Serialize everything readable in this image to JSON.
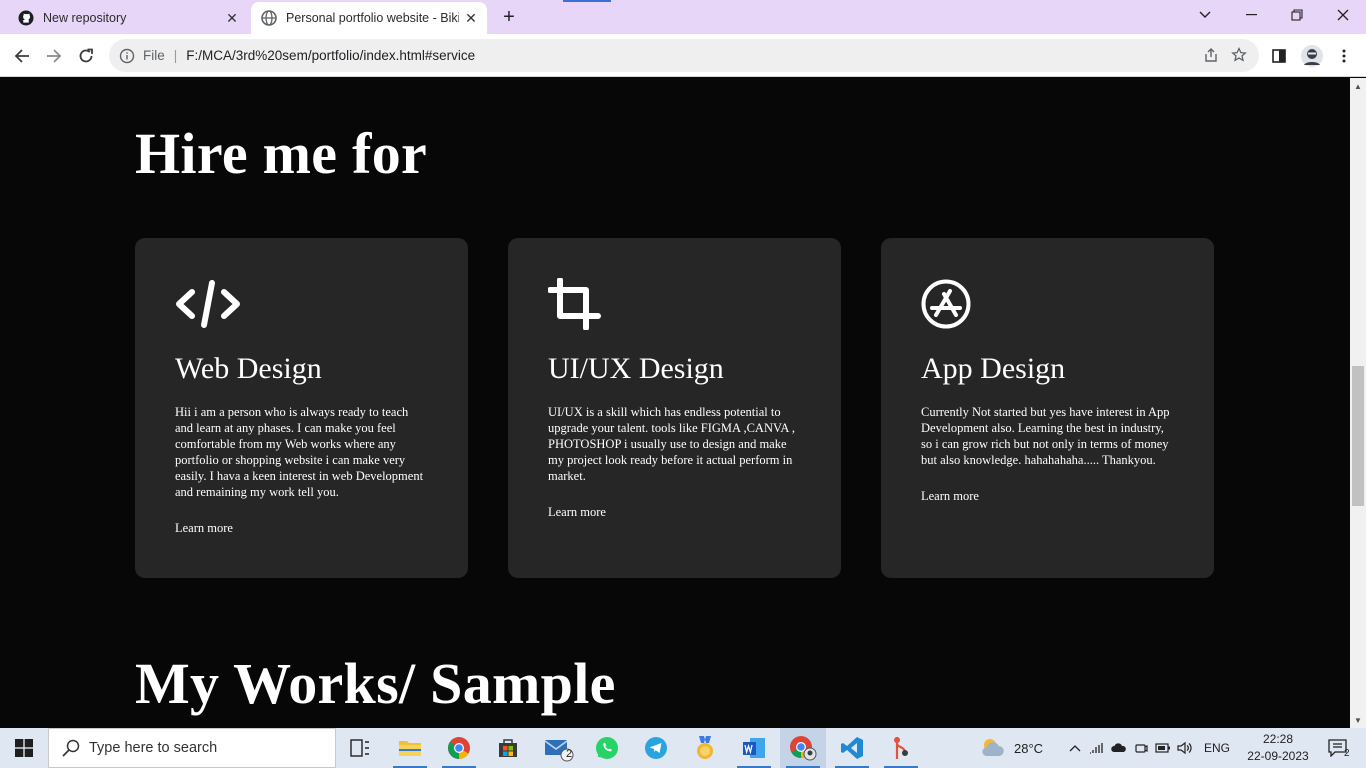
{
  "browser": {
    "tabs": [
      {
        "title": "New repository",
        "icon": "github-icon",
        "active": false
      },
      {
        "title": "Personal portfolio website - Biki",
        "icon": "globe-icon",
        "active": true
      }
    ],
    "address": {
      "scheme_label": "File",
      "url": "F:/MCA/3rd%20sem/portfolio/index.html#service"
    }
  },
  "page": {
    "hire_title": "Hire me for",
    "cards": [
      {
        "icon": "code-icon",
        "title": "Web Design",
        "text": "Hii i am a person who is always ready to teach and learn at any phases. I can make you feel comfortable from my Web works where any portfolio or shopping website i can make very easily. I hava a keen interest in web Development and remaining my work tell you.",
        "link": "Learn more"
      },
      {
        "icon": "crop-icon",
        "title": "UI/UX Design",
        "text": "UI/UX is a skill which has endless potential to upgrade your talent. tools like FIGMA ,CANVA , PHOTOSHOP i usually use to design and make my project look ready before it actual perform in market.",
        "link": "Learn more"
      },
      {
        "icon": "app-store-icon",
        "title": "App Design",
        "text": "Currently Not started but yes have interest in App Development also. Learning the best in industry, so i can grow rich but not only in terms of money but also knowledge. hahahahaha..... Thankyou.",
        "link": "Learn more"
      }
    ],
    "works_title": "My Works/ Sample"
  },
  "taskbar": {
    "search_placeholder": "Type here to search",
    "weather": "28°C",
    "language": "ENG",
    "time": "22:28",
    "date": "22-09-2023",
    "mail_badge": "2",
    "notification_badge": "2"
  },
  "colors": {
    "page_bg": "#070707",
    "card_bg": "#262626",
    "tabstrip_bg": "#e8d6f8",
    "taskbar_bg": "#dfe7f2"
  }
}
